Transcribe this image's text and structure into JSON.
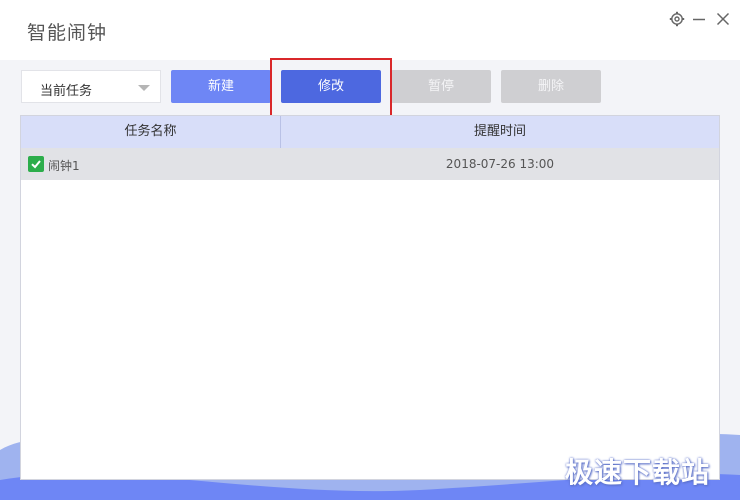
{
  "window": {
    "title": "智能闹钟",
    "controls": {
      "settings_icon": "gear-icon",
      "minimize_icon": "minimize-icon",
      "close_icon": "close-icon"
    }
  },
  "toolbar": {
    "filter_select": {
      "value": "当前任务"
    },
    "buttons": {
      "new": "新建",
      "edit": "修改",
      "pause": "暂停",
      "delete": "删除"
    }
  },
  "table": {
    "columns": [
      "任务名称",
      "提醒时间"
    ],
    "rows": [
      {
        "checked": true,
        "name": "闹钟1",
        "time": "2018-07-26 13:00"
      }
    ]
  },
  "watermark": "极速下载站",
  "colors": {
    "primary": "#6e86f5",
    "primary_active": "#4d68e0",
    "disabled": "#cfcfd2",
    "highlight_border": "#d9272a",
    "checkbox": "#2cad4b",
    "table_header": "#d8def9"
  }
}
